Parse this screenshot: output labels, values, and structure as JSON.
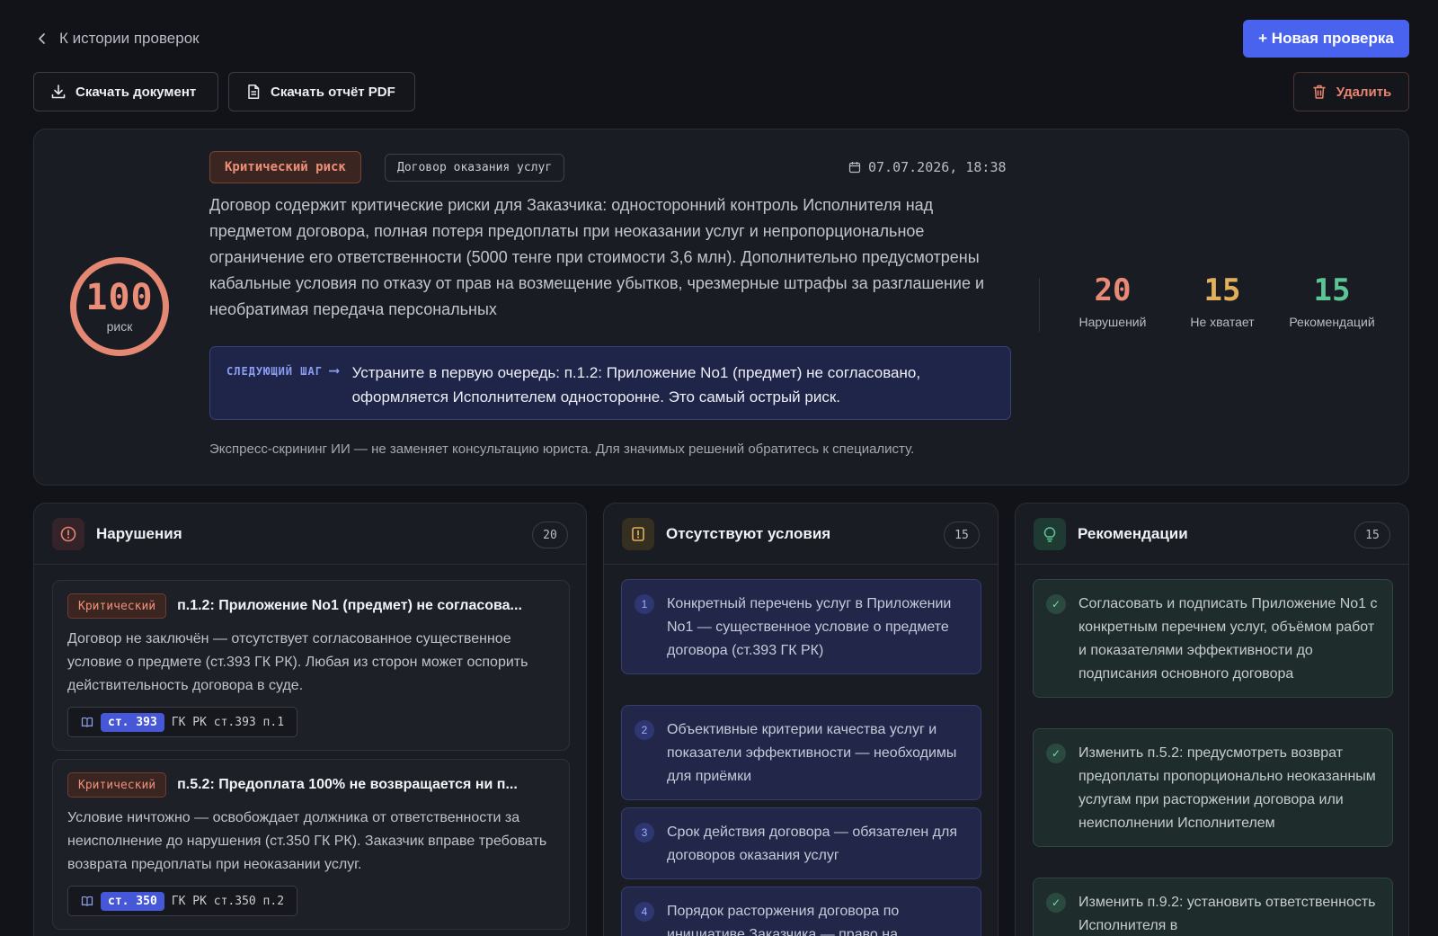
{
  "nav": {
    "back_label": "К истории проверок",
    "new_check_label": "+ Новая проверка"
  },
  "toolbar": {
    "download_doc_label": "Скачать документ",
    "download_pdf_label": "Скачать отчёт PDF",
    "delete_label": "Удалить"
  },
  "summary": {
    "score": "100",
    "score_label": "риск",
    "risk_badge": "Критический риск",
    "contract_type": "Договор оказания услуг",
    "datetime": "07.07.2026, 18:38",
    "text": "Договор содержит критические риски для Заказчика: односторонний контроль Исполнителя над предметом договора, полная потеря предоплаты при неоказании услуг и непропорциональное ограничение его ответственности (5000 тенге при стоимости 3,6 млн). Дополнительно предусмотрены кабальные условия по отказу от прав на возмещение убытков, чрезмерные штрафы за разглашение и необратимая передача персональных",
    "next_step_label": "СЛЕДУЮЩИЙ ШАГ",
    "next_step_text": "Устраните в первую очередь: п.1.2: Приложение No1 (предмет) не согласовано, оформляется Исполнителем односторонне. Это самый острый риск.",
    "disclaimer": "Экспресс-скрининг ИИ — не заменяет консультацию юриста. Для значимых решений обратитесь к специалисту.",
    "stats": [
      {
        "value": "20",
        "label": "Нарушений",
        "color": "#e98a76"
      },
      {
        "value": "15",
        "label": "Не хватает",
        "color": "#e2b05a"
      },
      {
        "value": "15",
        "label": "Рекомендаций",
        "color": "#5cc596"
      }
    ]
  },
  "violations": {
    "title": "Нарушения",
    "count": "20",
    "icon": "alert-circle-icon",
    "items": [
      {
        "severity": "Критический",
        "title": "п.1.2: Приложение No1 (предмет) не согласова...",
        "desc": "Договор не заключён — отсутствует согласованное существенное условие о предмете (ст.393 ГК РК). Любая из сторон может оспорить действительность договора в суде.",
        "ref_tag": "ст. 393",
        "ref_text": "ГК РК ст.393 п.1"
      },
      {
        "severity": "Критический",
        "title": "п.5.2: Предоплата 100% не возвращается ни п...",
        "desc": "Условие ничтожно — освобождает должника от ответственности за неисполнение до нарушения (ст.350 ГК РК). Заказчик вправе требовать возврата предоплаты при неоказании услуг.",
        "ref_tag": "ст. 350",
        "ref_text": "ГК РК ст.350 п.2"
      }
    ]
  },
  "missing": {
    "title": "Отсутствуют условия",
    "count": "15",
    "icon": "alert-square-icon",
    "items": [
      {
        "num": "1",
        "text": "Конкретный перечень услуг в Приложении No1 — существенное условие о предмете договора (ст.393 ГК РК)"
      },
      {
        "num": "2",
        "text": "Объективные критерии качества услуг и показатели эффективности — необходимы для приёмки"
      },
      {
        "num": "3",
        "text": "Срок действия договора — обязателен для договоров оказания услуг"
      },
      {
        "num": "4",
        "text": "Порядок расторжения договора по инициативе Заказчика — право на"
      }
    ]
  },
  "recommendations": {
    "title": "Рекомендации",
    "count": "15",
    "icon": "lightbulb-icon",
    "items": [
      {
        "text": "Согласовать и подписать Приложение No1 с конкретным перечнем услуг, объёмом работ и показателями эффективности до подписания основного договора"
      },
      {
        "text": "Изменить п.5.2: предусмотреть возврат предоплаты пропорционально неоказанным услугам при расторжении договора или неисполнении Исполнителем"
      },
      {
        "text": "Изменить п.9.2: установить ответственность Исполнителя в"
      }
    ]
  }
}
